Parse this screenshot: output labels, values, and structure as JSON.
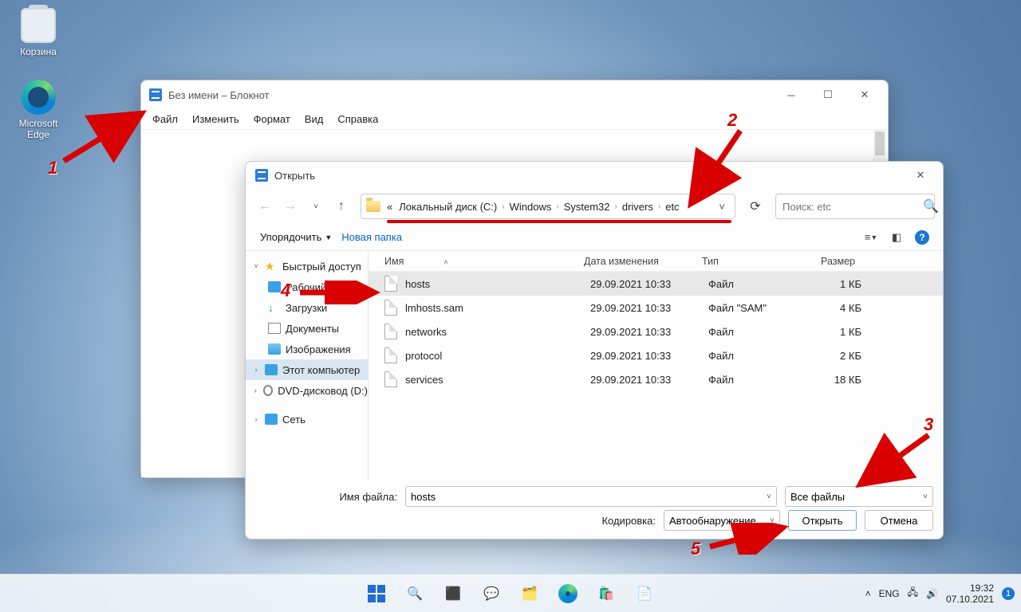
{
  "desktop": {
    "recycle": "Корзина",
    "edge": "Microsoft Edge"
  },
  "notepad": {
    "title": "Без имени – Блокнот",
    "menu": {
      "file": "Файл",
      "edit": "Изменить",
      "format": "Формат",
      "view": "Вид",
      "help": "Справка"
    }
  },
  "dialog": {
    "title": "Открыть",
    "organize": "Упорядочить",
    "new_folder": "Новая папка",
    "breadcrumb": {
      "pre": "«",
      "disk": "Локальный диск (C:)",
      "p1": "Windows",
      "p2": "System32",
      "p3": "drivers",
      "p4": "etc"
    },
    "search_placeholder": "Поиск: etc",
    "tree": {
      "quick": "Быстрый доступ",
      "desktop": "Рабочий стол",
      "downloads": "Загрузки",
      "documents": "Документы",
      "pictures": "Изображения",
      "thispc": "Этот компьютер",
      "dvd": "DVD-дисковод (D:)",
      "network": "Сеть"
    },
    "columns": {
      "name": "Имя",
      "date": "Дата изменения",
      "type": "Тип",
      "size": "Размер"
    },
    "files": [
      {
        "name": "hosts",
        "date": "29.09.2021 10:33",
        "type": "Файл",
        "size": "1 КБ"
      },
      {
        "name": "lmhosts.sam",
        "date": "29.09.2021 10:33",
        "type": "Файл \"SAM\"",
        "size": "4 КБ"
      },
      {
        "name": "networks",
        "date": "29.09.2021 10:33",
        "type": "Файл",
        "size": "1 КБ"
      },
      {
        "name": "protocol",
        "date": "29.09.2021 10:33",
        "type": "Файл",
        "size": "2 КБ"
      },
      {
        "name": "services",
        "date": "29.09.2021 10:33",
        "type": "Файл",
        "size": "18 КБ"
      }
    ],
    "filename_label": "Имя файла:",
    "filename_value": "hosts",
    "filter_value": "Все файлы",
    "encoding_label": "Кодировка:",
    "encoding_value": "Автообнаружение",
    "open": "Открыть",
    "cancel": "Отмена"
  },
  "annotations": {
    "n1": "1",
    "n2": "2",
    "n3": "3",
    "n4": "4",
    "n5": "5"
  },
  "taskbar": {
    "lang": "ENG",
    "time": "19:32",
    "date": "07.10.2021"
  }
}
